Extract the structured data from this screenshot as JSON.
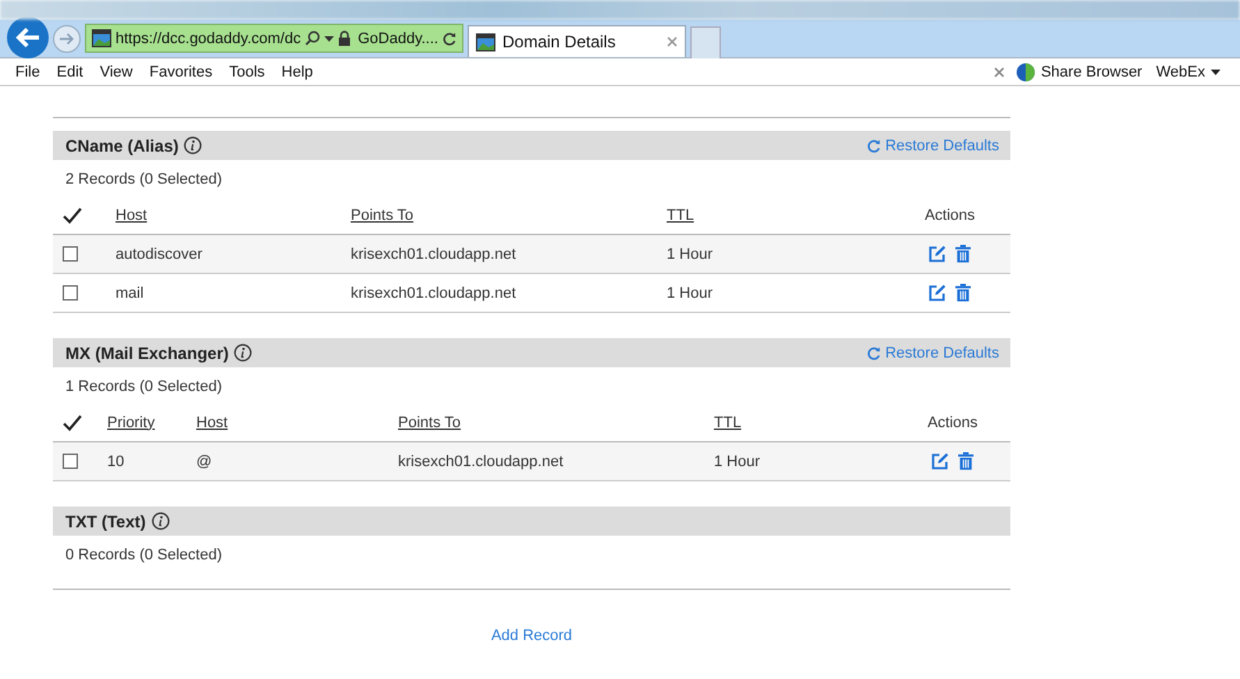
{
  "browser": {
    "url_host": "https://dcc.godaddy.com/dc",
    "site_label": "GoDaddy....",
    "tabs": [
      {
        "title": "Domain Details",
        "selected": true
      }
    ],
    "menu": [
      "File",
      "Edit",
      "View",
      "Favorites",
      "Tools",
      "Help"
    ],
    "share": "Share Browser",
    "webex": "WebEx"
  },
  "sections": [
    {
      "title": "CName (Alias)",
      "restore": "Restore Defaults",
      "count": "2 Records (0 Selected)",
      "columns": [
        "Host",
        "Points To",
        "TTL",
        "Actions"
      ],
      "rows": [
        {
          "cells": [
            "autodiscover",
            "krisexch01.cloudapp.net",
            "1 Hour"
          ],
          "checked": false
        },
        {
          "cells": [
            "mail",
            "krisexch01.cloudapp.net",
            "1 Hour"
          ],
          "checked": false
        }
      ]
    },
    {
      "title": "MX (Mail Exchanger)",
      "restore": "Restore Defaults",
      "count": "1 Records (0 Selected)",
      "columns": [
        "Priority",
        "Host",
        "Points To",
        "TTL",
        "Actions"
      ],
      "rows": [
        {
          "cells": [
            "10",
            "@",
            "krisexch01.cloudapp.net",
            "1 Hour"
          ],
          "checked": false
        }
      ]
    },
    {
      "title": "TXT (Text)",
      "count": "0 Records (0 Selected)"
    }
  ],
  "add_record": "Add Record"
}
